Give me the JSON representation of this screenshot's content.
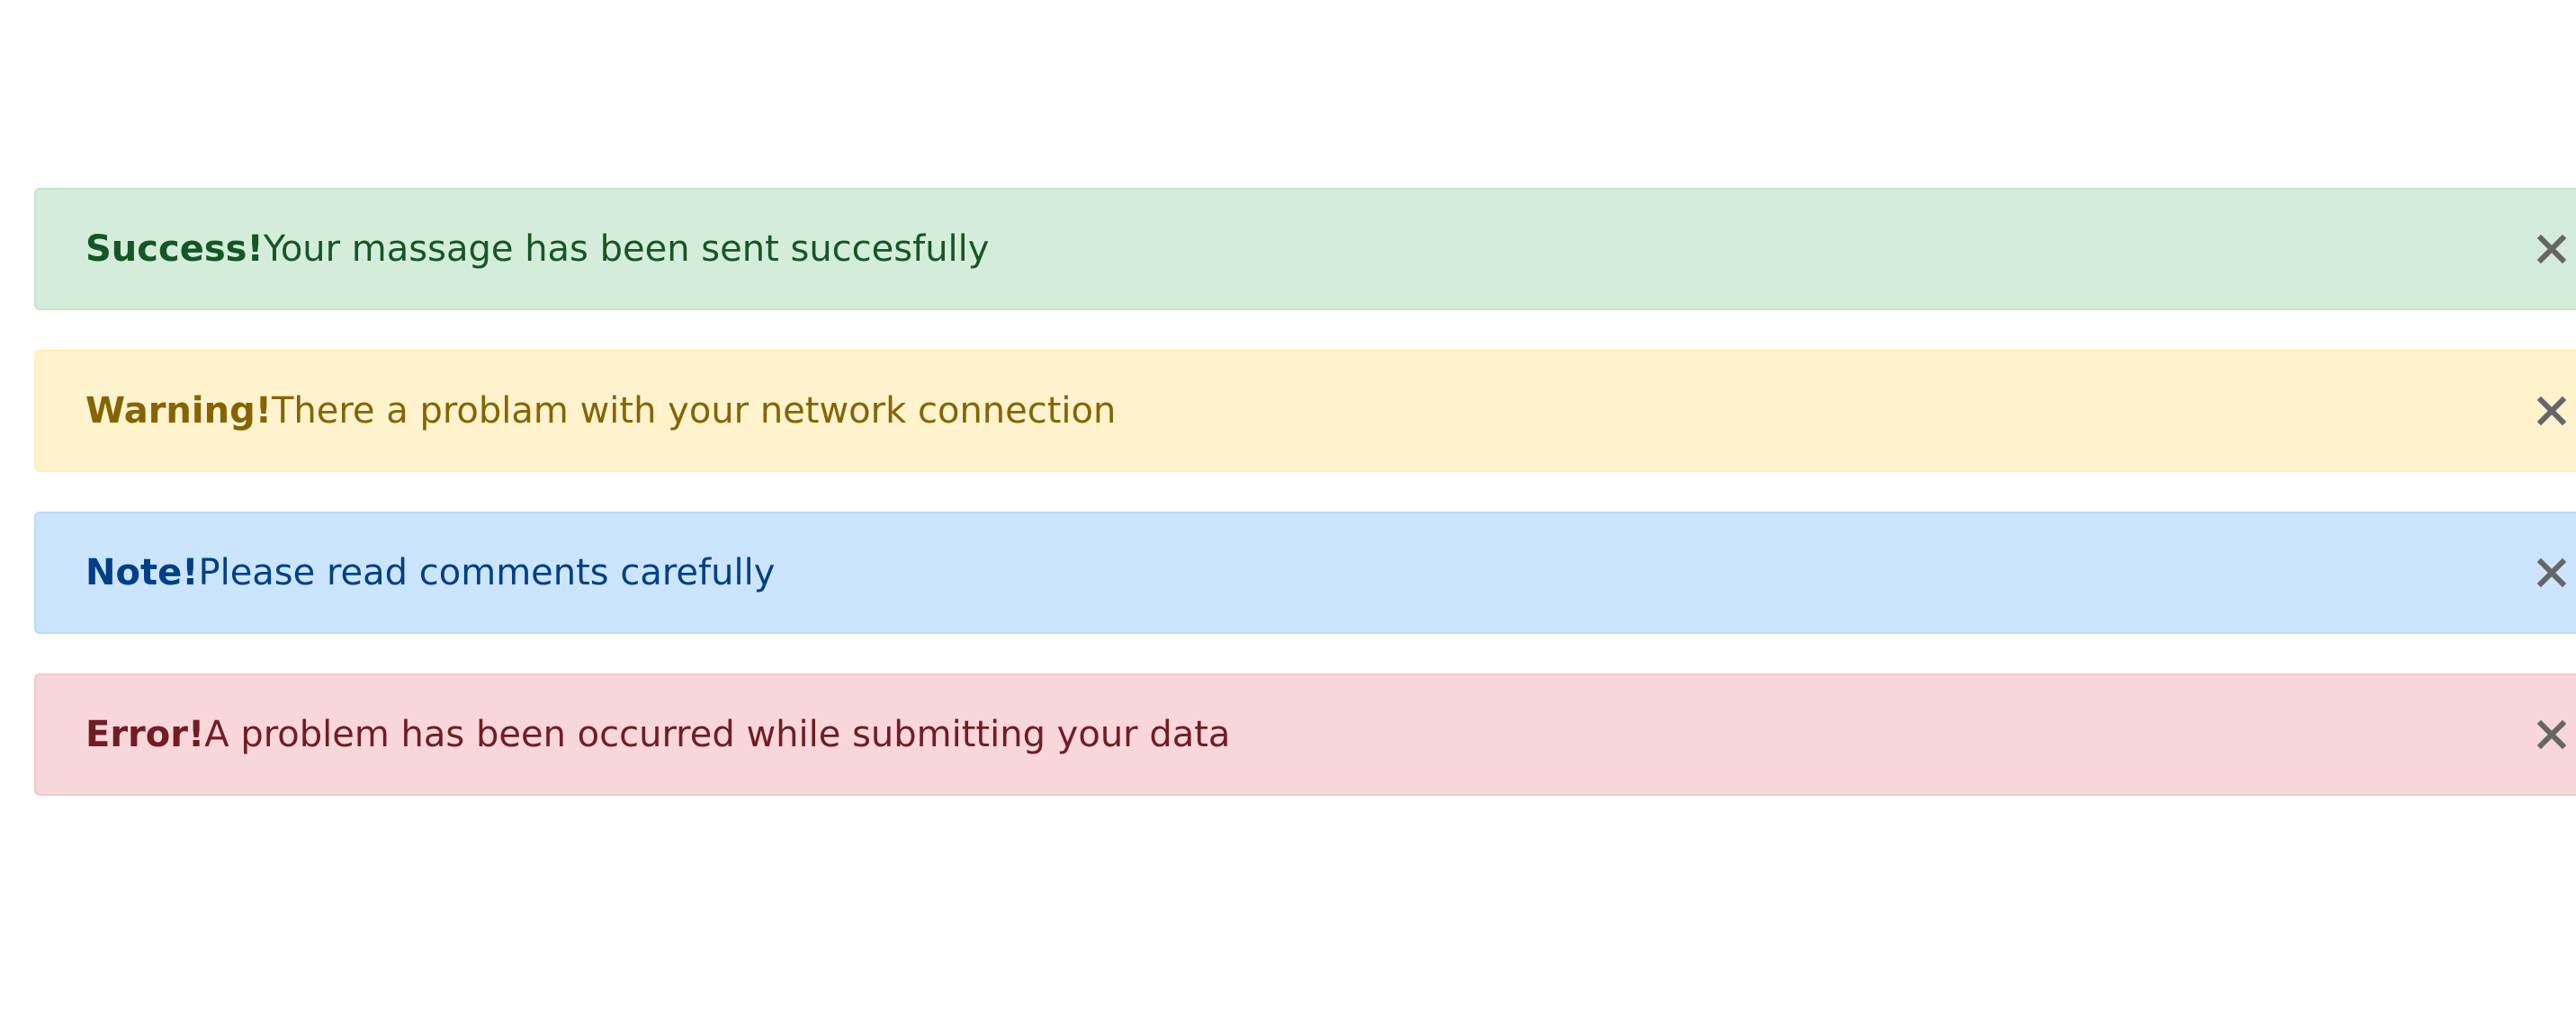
{
  "alerts": [
    {
      "type": "success",
      "title": "Success!",
      "message": "Your massage has been sent succesfully",
      "close_icon": "close-icon"
    },
    {
      "type": "warning",
      "title": "Warning!",
      "message": "There a problam with your network connection",
      "close_icon": "close-icon"
    },
    {
      "type": "note",
      "title": "Note!",
      "message": "Please read comments carefully",
      "close_icon": "close-icon"
    },
    {
      "type": "error",
      "title": "Error!",
      "message": "A problem has been occurred while submitting your data",
      "close_icon": "close-icon"
    }
  ],
  "colors": {
    "success_bg": "#d4edda",
    "success_text": "#155724",
    "warning_bg": "#fff3cd",
    "warning_text": "#856404",
    "note_bg": "#cce5ff",
    "note_text": "#004085",
    "error_bg": "#f8d7da",
    "error_text": "#721c24",
    "close_icon": "#666666"
  }
}
